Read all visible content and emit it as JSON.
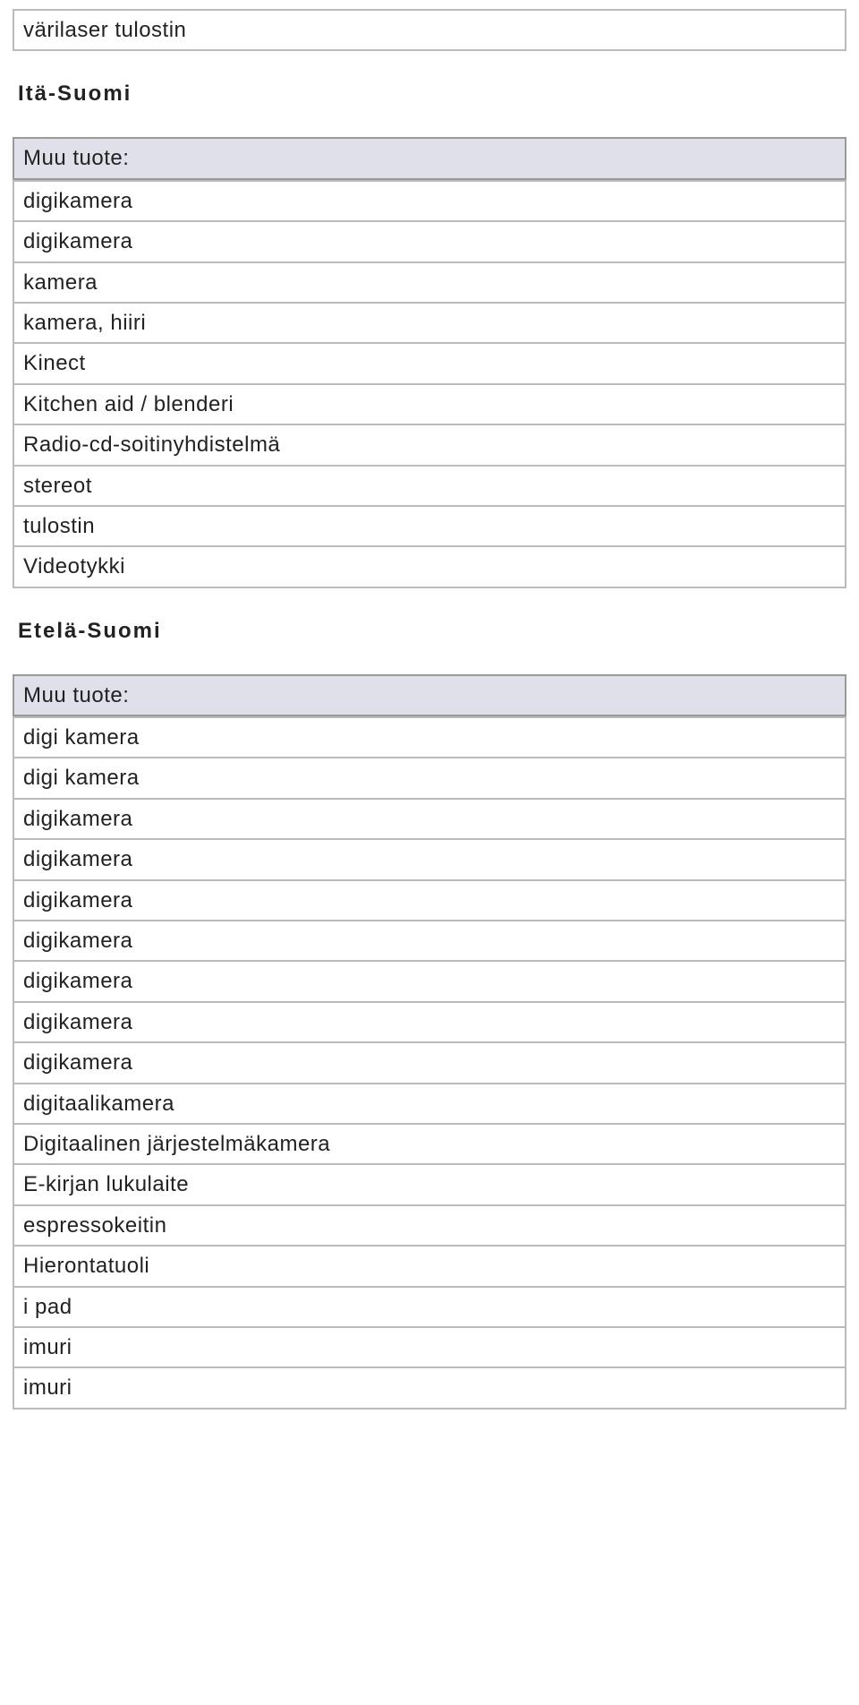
{
  "first_row": "värilaser tulostin",
  "sections": [
    {
      "title": "Itä-Suomi",
      "header": "Muu tuote:",
      "items": [
        "digikamera",
        "digikamera",
        "kamera",
        "kamera, hiiri",
        "Kinect",
        "Kitchen aid / blenderi",
        "Radio-cd-soitinyhdistelmä",
        "stereot",
        "tulostin",
        "Videotykki"
      ]
    },
    {
      "title": "Etelä-Suomi",
      "header": "Muu tuote:",
      "items": [
        "digi kamera",
        "digi kamera",
        "digikamera",
        "digikamera",
        "digikamera",
        "digikamera",
        "digikamera",
        "digikamera",
        "digikamera",
        "digitaalikamera",
        "Digitaalinen järjestelmäkamera",
        "E-kirjan lukulaite",
        "espressokeitin",
        "Hierontatuoli",
        "i pad",
        "imuri",
        "imuri"
      ]
    }
  ]
}
